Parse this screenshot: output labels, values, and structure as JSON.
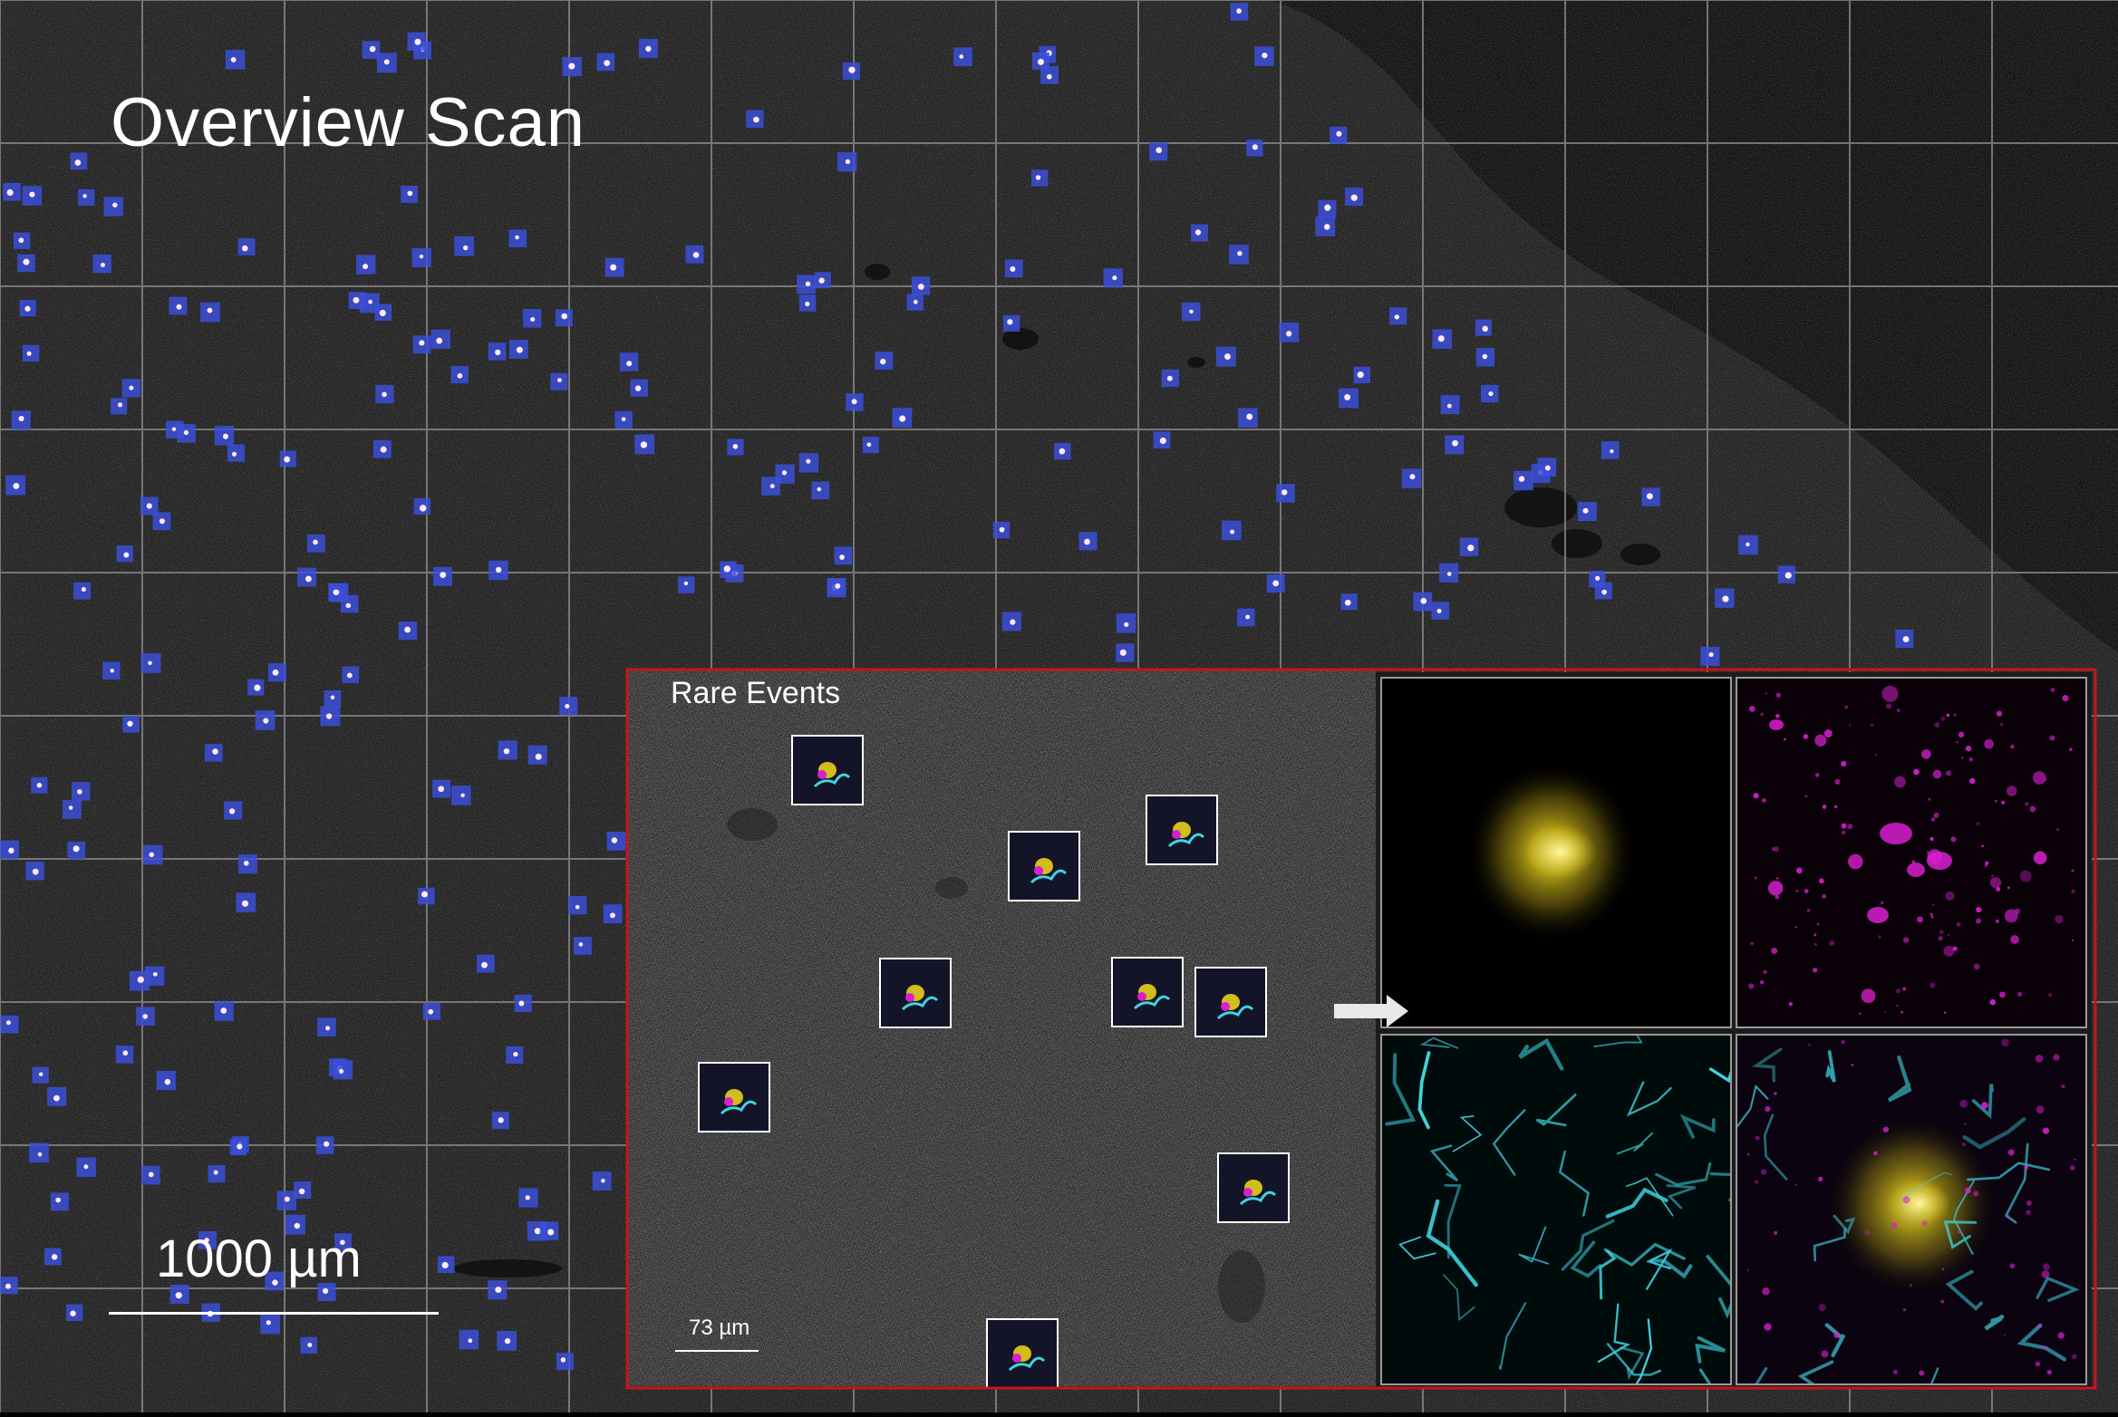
{
  "overview": {
    "title": "Overview Scan",
    "scale_bar_label": "1000 µm"
  },
  "inset": {
    "title": "Rare Events",
    "scale_bar_label": "73 µm",
    "border_color": "#c4161c"
  },
  "channels": {
    "yellow": "#e6cf1a",
    "magenta": "#d81fd0",
    "cyan": "#3fd4e0",
    "marker_blue": "#3b4fd8"
  }
}
